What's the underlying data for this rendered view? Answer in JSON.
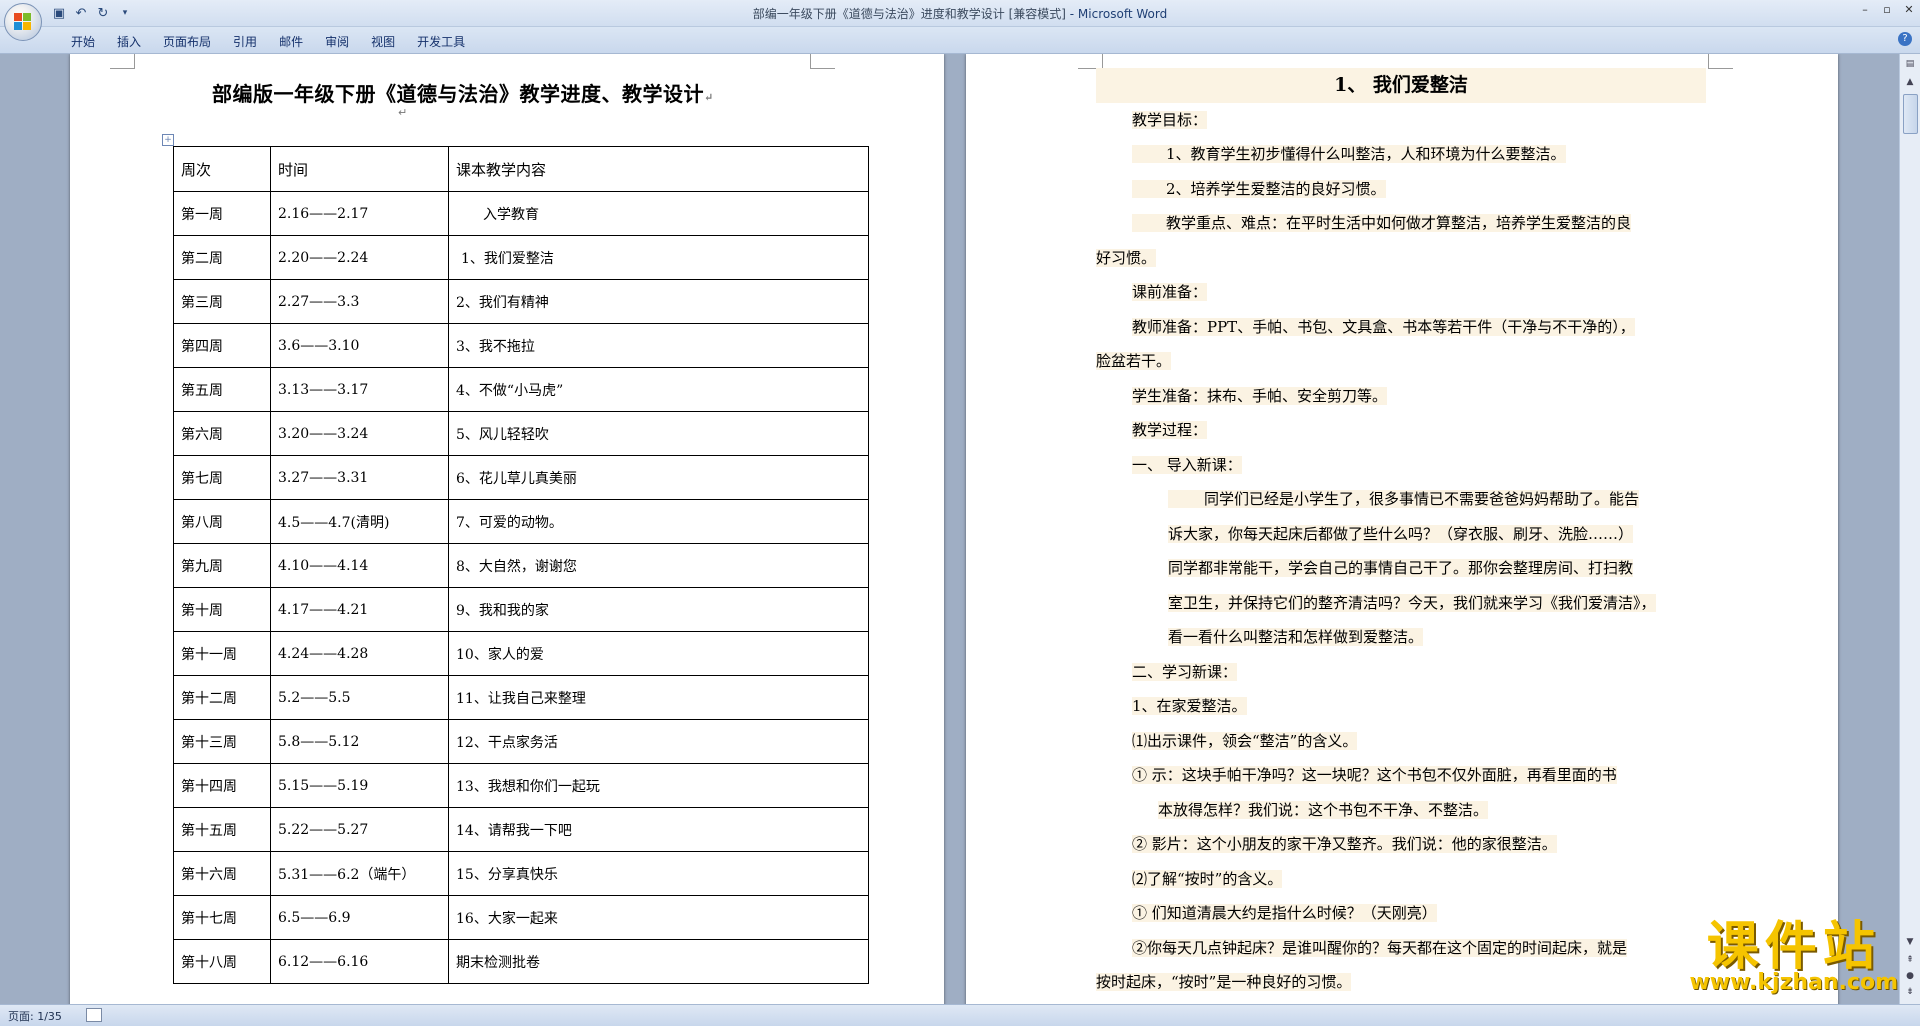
{
  "titlebar": {
    "title": "部编一年级下册《道德与法治》进度和教学设计 [兼容模式]",
    "app": " - Microsoft Word",
    "qat": [
      "save-icon",
      "undo-icon",
      "redo-icon",
      "customize-icon"
    ],
    "controls": [
      "–",
      "▫",
      "✕"
    ]
  },
  "ribbon": {
    "tabs": [
      "开始",
      "插入",
      "页面布局",
      "引用",
      "邮件",
      "审阅",
      "视图",
      "开发工具"
    ],
    "help": "?"
  },
  "left_page": {
    "title": "部编版一年级下册《道德与法治》教学进度、教学设计",
    "table": {
      "headers": [
        "周次",
        "时间",
        "课本教学内容"
      ],
      "rows": [
        [
          "第一周",
          "2.16——2.17",
          "入学教育"
        ],
        [
          "第二周",
          "2.20——2.24",
          "1、我们爱整洁"
        ],
        [
          "第三周",
          "2.27——3.3",
          "2、我们有精神"
        ],
        [
          "第四周",
          "3.6——3.10",
          "3、我不拖拉"
        ],
        [
          "第五周",
          "3.13——3.17",
          "4、不做“小马虎”"
        ],
        [
          "第六周",
          "3.20——3.24",
          "5、风儿轻轻吹"
        ],
        [
          "第七周",
          "3.27——3.31",
          "6、花儿草儿真美丽"
        ],
        [
          "第八周",
          "4.5——4.7(清明)",
          "7、可爱的动物。"
        ],
        [
          "第九周",
          "4.10——4.14",
          "8、大自然，谢谢您"
        ],
        [
          "第十周",
          "4.17——4.21",
          "9、我和我的家"
        ],
        [
          "第十一周",
          "4.24——4.28",
          "10、家人的爱"
        ],
        [
          "第十二周",
          "5.2——5.5",
          "11、让我自己来整理"
        ],
        [
          "第十三周",
          "5.8——5.12",
          "12、干点家务活"
        ],
        [
          "第十四周",
          "5.15——5.19",
          "13、我想和你们一起玩"
        ],
        [
          "第十五周",
          "5.22——5.27",
          "14、请帮我一下吧"
        ],
        [
          "第十六周",
          "5.31——6.2（端午）",
          "15、分享真快乐"
        ],
        [
          "第十七周",
          "6.5——6.9",
          "16、大家一起来"
        ],
        [
          "第十八周",
          "6.12——6.16",
          "期末检测批卷"
        ]
      ]
    }
  },
  "right_page": {
    "heading": "1、 我们爱整洁",
    "lines": [
      "教学目标：",
      "1、教育学生初步懂得什么叫整洁，人和环境为什么要整洁。",
      "2、培养学生爱整洁的良好习惯。",
      "教学重点、难点：在平时生活中如何做才算整洁，培养学生爱整洁的良",
      "好习惯。",
      "课前准备：",
      "教师准备：PPT、手帕、书包、文具盒、书本等若干件（干净与不干净的），",
      "脸盆若干。",
      "学生准备：抹布、手帕、安全剪刀等。",
      "教学过程：",
      "一、   导入新课：",
      "同学们已经是小学生了，很多事情已不需要爸爸妈妈帮助了。能告",
      "诉大家，你每天起床后都做了些什么吗？（穿衣服、刷牙、洗脸……）",
      "同学都非常能干，学会自己的事情自己干了。那你会整理房间、打扫教",
      "室卫生，并保持它们的整齐清洁吗？今天，我们就来学习《我们爱清洁》，",
      "看一看什么叫整洁和怎样做到爱整洁。",
      "二、学习新课：",
      "1、在家爱整洁。",
      "⑴出示课件，领会“整洁”的含义。",
      "① 示：这块手帕干净吗？这一块呢？这个书包不仅外面脏，再看里面的书",
      "本放得怎样？我们说：这个书包不干净、不整洁。",
      "② 影片：这个小朋友的家干净又整齐。我们说：他的家很整洁。",
      "⑵了解“按时”的含义。",
      "① 们知道清晨大约是指什么时候？（天刚亮）",
      "②你每天几点钟起床？是谁叫醒你的？每天都在这个固定的时间起床，就是",
      "按时起床，“按时”是一种良好的习惯。"
    ]
  },
  "statusbar": {
    "page": "页面: 1/35"
  },
  "watermark": {
    "logo": "课件站",
    "url": "www.kjzhan.com"
  }
}
